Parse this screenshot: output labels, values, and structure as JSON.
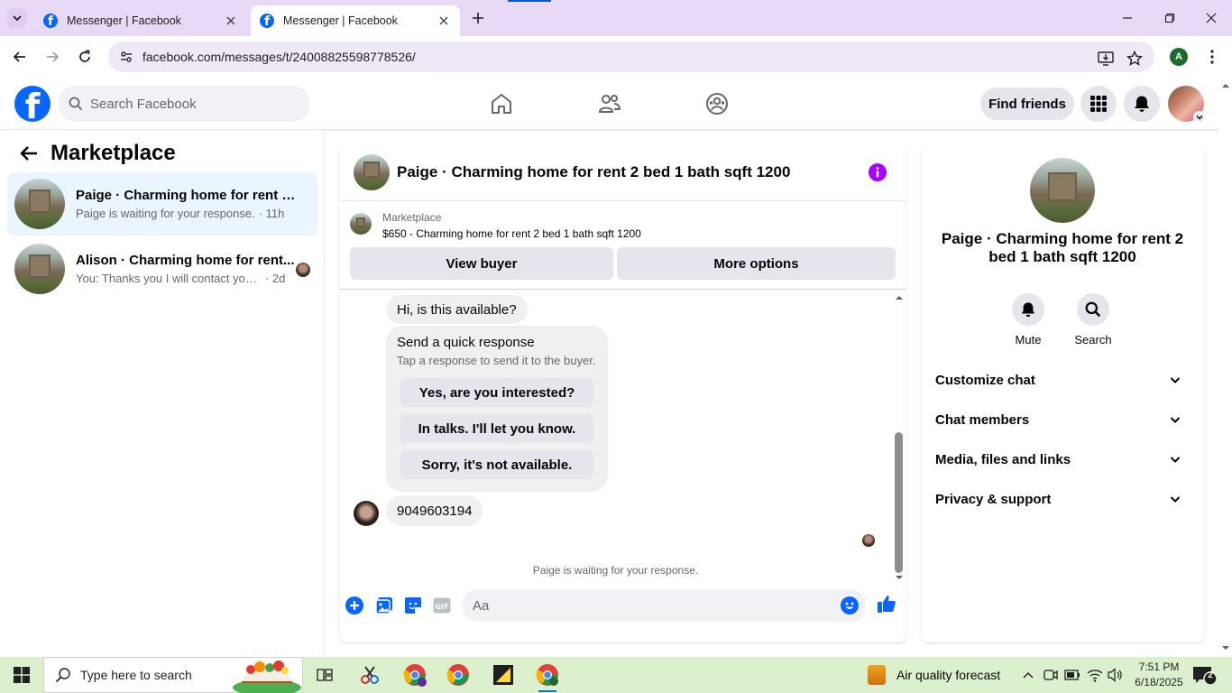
{
  "browser": {
    "tabs": [
      {
        "title": "Messenger | Facebook",
        "active": false
      },
      {
        "title": "Messenger | Facebook",
        "active": true
      }
    ],
    "url": "facebook.com/messages/t/24008825598778526/",
    "profile_initial": "A"
  },
  "fb_header": {
    "logo_letter": "f",
    "search_placeholder": "Search Facebook",
    "find_friends_label": "Find friends",
    "nav_icons": [
      "home-icon",
      "friends-icon",
      "groups-icon"
    ],
    "accent_color": "#0866ff"
  },
  "sidebar": {
    "title": "Marketplace",
    "threads": [
      {
        "name": "Paige · Charming home for rent 2 bed 1 bath sqft 1200",
        "name_display": "Paige · Charming home for rent 2 ...",
        "snippet": "Paige is waiting for your response.",
        "time": "· 11h",
        "active": true
      },
      {
        "name": "Alison · Charming home for rent 2 bed 1 bath sqft 1200",
        "name_display": "Alison · Charming home for rent...",
        "snippet": "You: Thanks you I will contact you ...",
        "time": "· 2d",
        "active": false
      }
    ]
  },
  "chat": {
    "title": "Paige · Charming home for rent 2 bed 1 bath sqft 1200",
    "marketplace_label": "Marketplace",
    "listing": "$650 - Charming home for rent 2 bed 1 bath sqft 1200",
    "view_buyer_label": "View buyer",
    "more_options_label": "More options",
    "messages": {
      "first": "Hi, is this available?",
      "quick_response_title": "Send a quick response",
      "quick_response_sub": "Tap a response to send it to the buyer.",
      "quick_replies": [
        "Yes, are you interested?",
        "In talks. I'll let you know.",
        "Sorry, it's not available."
      ],
      "phone": "9049603194"
    },
    "waiting_text": "Paige is waiting for your response.",
    "composer_placeholder": "Aa"
  },
  "right_panel": {
    "name": "Paige · Charming home for rent 2 bed 1 bath sqft 1200",
    "actions": [
      {
        "label": "Mute",
        "icon": "bell-icon"
      },
      {
        "label": "Search",
        "icon": "search-icon"
      }
    ],
    "sections": [
      "Customize chat",
      "Chat members",
      "Media, files and links",
      "Privacy & support"
    ]
  },
  "taskbar": {
    "search_placeholder": "Type here to search",
    "weather": "Air quality forecast",
    "time": "7:51 PM",
    "date": "6/18/2025",
    "notification_count": "2"
  }
}
